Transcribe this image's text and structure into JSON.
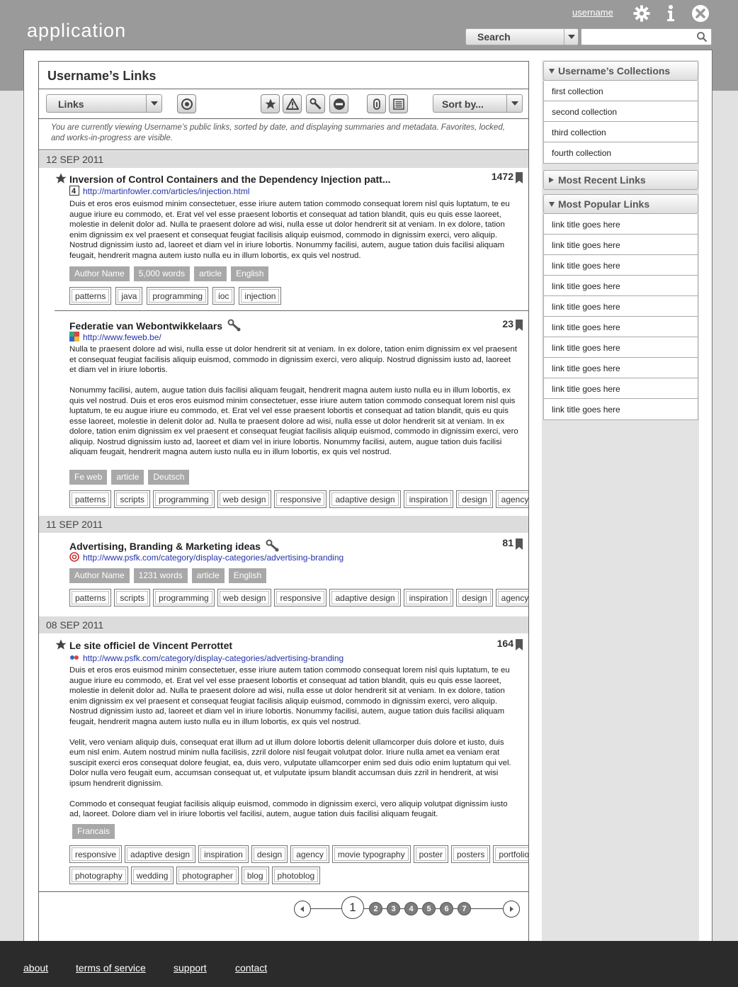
{
  "header": {
    "app_title": "application",
    "username": "username",
    "search_select": "Search",
    "search_placeholder": "",
    "icons": [
      "gear-icon",
      "info-icon",
      "close-icon",
      "search-icon"
    ]
  },
  "main": {
    "title": "Username’s Links",
    "links_select": "Links",
    "sort_select": "Sort by...",
    "info": "You are currently viewing Username’s public links, sorted by date, and displaying summaries and metadata. Favorites, locked, and works-in-progress are visible.",
    "toolbar_icons": [
      "eye-icon",
      "star-icon",
      "warning-icon",
      "wrench-icon",
      "minus-icon",
      "paperclip-icon",
      "list-icon"
    ]
  },
  "groups": [
    {
      "date": "12 SEP 2011",
      "entries": [
        {
          "favorite": true,
          "title": "Inversion of Control Containers and the Dependency Injection patt...",
          "count": "1472",
          "url": "http://martinfowler.com/articles/injection.html",
          "paragraphs": [
            "Duis et eros eros euismod minim consectetuer, esse iriure autem tation commodo consequat lorem nisl quis luptatum, te eu augue iriure eu commodo, et. Erat vel vel esse praesent lobortis et consequat ad tation blandit, quis eu quis esse laoreet, molestie in delenit dolor ad. Nulla te praesent dolore ad wisi, nulla esse ut dolor hendrerit sit at veniam. In ex dolore, tation enim dignissim ex vel praesent et consequat feugiat facilisis aliquip euismod, commodo in dignissim exerci, vero aliquip. Nostrud dignissim iusto ad, laoreet et diam vel in iriure lobortis. Nonummy facilisi, autem, augue tation duis facilisi aliquam feugait, hendrerit magna autem iusto nulla eu in illum lobortis, ex quis vel nostrud."
          ],
          "meta_tags": [
            "Author Name",
            "5,000 words",
            "article",
            "English"
          ],
          "tags": [
            "patterns",
            "java",
            "programming",
            "ioc",
            "injection"
          ]
        },
        {
          "favorite": false,
          "title": "Federatie van Webontwikkelaars",
          "count": "23",
          "url": "http://www.feweb.be/",
          "paragraphs": [
            "Nulla te praesent dolore ad wisi, nulla esse ut dolor hendrerit sit at veniam. In ex dolore, tation enim dignissim ex vel praesent et consequat feugiat facilisis aliquip euismod, commodo in dignissim exerci, vero aliquip. Nostrud dignissim iusto ad, laoreet et diam vel in iriure lobortis.",
            "Nonummy facilisi, autem, augue tation duis facilisi aliquam feugait, hendrerit magna autem iusto nulla eu in illum lobortis, ex quis vel nostrud. Duis et eros eros euismod minim consectetuer, esse iriure autem tation commodo consequat lorem nisl quis luptatum, te eu augue iriure eu commodo, et. Erat vel vel esse praesent lobortis et consequat ad tation blandit, quis eu quis esse laoreet, molestie in delenit dolor ad. Nulla te praesent dolore ad wisi, nulla esse ut dolor hendrerit sit at veniam. In ex dolore, tation enim dignissim ex vel praesent et consequat feugiat facilisis aliquip euismod, commodo in dignissim exerci, vero aliquip. Nostrud dignissim iusto ad, laoreet et diam vel in iriure lobortis. Nonummy facilisi, autem, augue tation duis facilisi aliquam feugait, hendrerit magna autem iusto nulla eu in illum lobortis, ex quis vel nostrud."
          ],
          "meta_tags": [
            "Fe web",
            "article",
            "Deutsch"
          ],
          "tags": [
            "patterns",
            "scripts",
            "programming",
            "web design",
            "responsive",
            "adaptive design",
            "inspiration",
            "design",
            "agency"
          ]
        }
      ]
    },
    {
      "date": "11 SEP 2011",
      "entries": [
        {
          "favorite": false,
          "title": "Advertising, Branding & Marketing ideas",
          "count": "81",
          "url": "http://www.psfk.com/category/display-categories/advertising-branding",
          "paragraphs": [],
          "meta_tags": [
            "Author Name",
            "1231 words",
            "article",
            "English"
          ],
          "tags": [
            "patterns",
            "scripts",
            "programming",
            "web design",
            "responsive",
            "adaptive design",
            "inspiration",
            "design",
            "agency"
          ]
        }
      ]
    },
    {
      "date": "08 SEP 2011",
      "entries": [
        {
          "favorite": true,
          "title": "Le site officiel de Vincent Perrottet",
          "count": "164",
          "url": "http://www.psfk.com/category/display-categories/advertising-branding",
          "paragraphs": [
            "Duis et eros eros euismod minim consectetuer, esse iriure autem tation commodo consequat lorem nisl quis luptatum, te eu augue iriure eu commodo, et. Erat vel vel esse praesent lobortis et consequat ad tation blandit, quis eu quis esse laoreet, molestie in delenit dolor ad. Nulla te praesent dolore ad wisi, nulla esse ut dolor hendrerit sit at veniam. In ex dolore, tation enim dignissim ex vel praesent et consequat feugiat facilisis aliquip euismod, commodo in dignissim exerci, vero aliquip. Nostrud dignissim iusto ad, laoreet et diam vel in iriure lobortis. Nonummy facilisi, autem, augue tation duis facilisi aliquam feugait, hendrerit magna autem iusto nulla eu in illum lobortis, ex quis vel nostrud.",
            "Velit, vero veniam aliquip duis, consequat erat illum ad ut illum dolore lobortis delenit ullamcorper duis dolore et iusto, duis eum nisl enim. Autem nostrud minim nulla facilisis, zzril dolore nisl feugait volutpat dolor. Iriure nulla amet ea veniam erat suscipit exerci eros consequat dolore feugiat, ea, duis vero, vulputate ullamcorper enim sed duis odio enim luptatum qui vel. Dolor nulla vero feugait eum, accumsan consequat ut, et vulputate ipsum blandit accumsan duis zzril in hendrerit, at wisi ipsum hendrerit dignissim.",
            "Commodo et consequat feugiat facilisis aliquip euismod, commodo in dignissim exerci, vero aliquip volutpat dignissim iusto ad, laoreet. Dolore diam vel in iriure lobortis vel facilisi, autem, augue tation duis facilisi aliquam feugait."
          ],
          "meta_tags": [
            "Francais"
          ],
          "tags": [
            "responsive",
            "adaptive design",
            "inspiration",
            "design",
            "agency",
            "movie typography",
            "poster",
            "posters",
            "portfolio",
            "photography",
            "wedding",
            "photographer",
            "blog",
            "photoblog"
          ]
        }
      ]
    }
  ],
  "pagination": {
    "current": "1",
    "pages": [
      "2",
      "3",
      "4",
      "5",
      "6",
      "7"
    ]
  },
  "sidebar": {
    "collections_title": "Username’s Collections",
    "collections": [
      "first collection",
      "second collection",
      "third collection",
      "fourth collection"
    ],
    "recent_title": "Most Recent Links",
    "popular_title": "Most Popular Links",
    "popular": [
      "link title goes here",
      "link title goes here",
      "link title goes here",
      "link title goes here",
      "link title goes here",
      "link title goes here",
      "link title goes here",
      "link title goes here",
      "link title goes here",
      "link title goes here"
    ]
  },
  "footer": {
    "links": [
      "about",
      "terms of service",
      "support",
      "contact"
    ]
  },
  "colors": {
    "header_bg": "#9a9a9a",
    "footer_bg": "#2b2b2b",
    "link_url": "#2233aa",
    "meta_tag_bg": "#a8a8a8"
  }
}
